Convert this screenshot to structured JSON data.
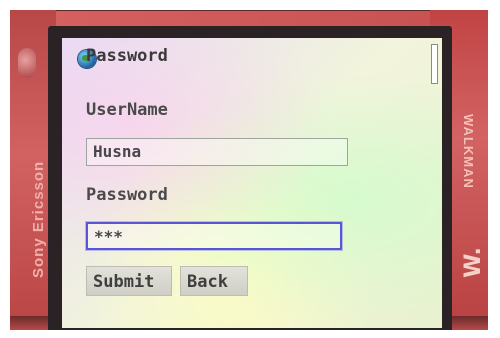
{
  "screen": {
    "title": "Password",
    "username_label": "UserName",
    "username_value": "Husna",
    "password_label": "Password",
    "password_value": "***",
    "submit_label": "Submit",
    "back_label": "Back"
  },
  "device": {
    "brand_left": "Sony Ericsson",
    "brand_right": "WALKMAN"
  },
  "icons": {
    "title_icon": "globe-icon",
    "right_logo": "walkman-logo-icon"
  },
  "colors": {
    "phone_body": "#c84b4b",
    "focus_border": "#5a55d6"
  }
}
